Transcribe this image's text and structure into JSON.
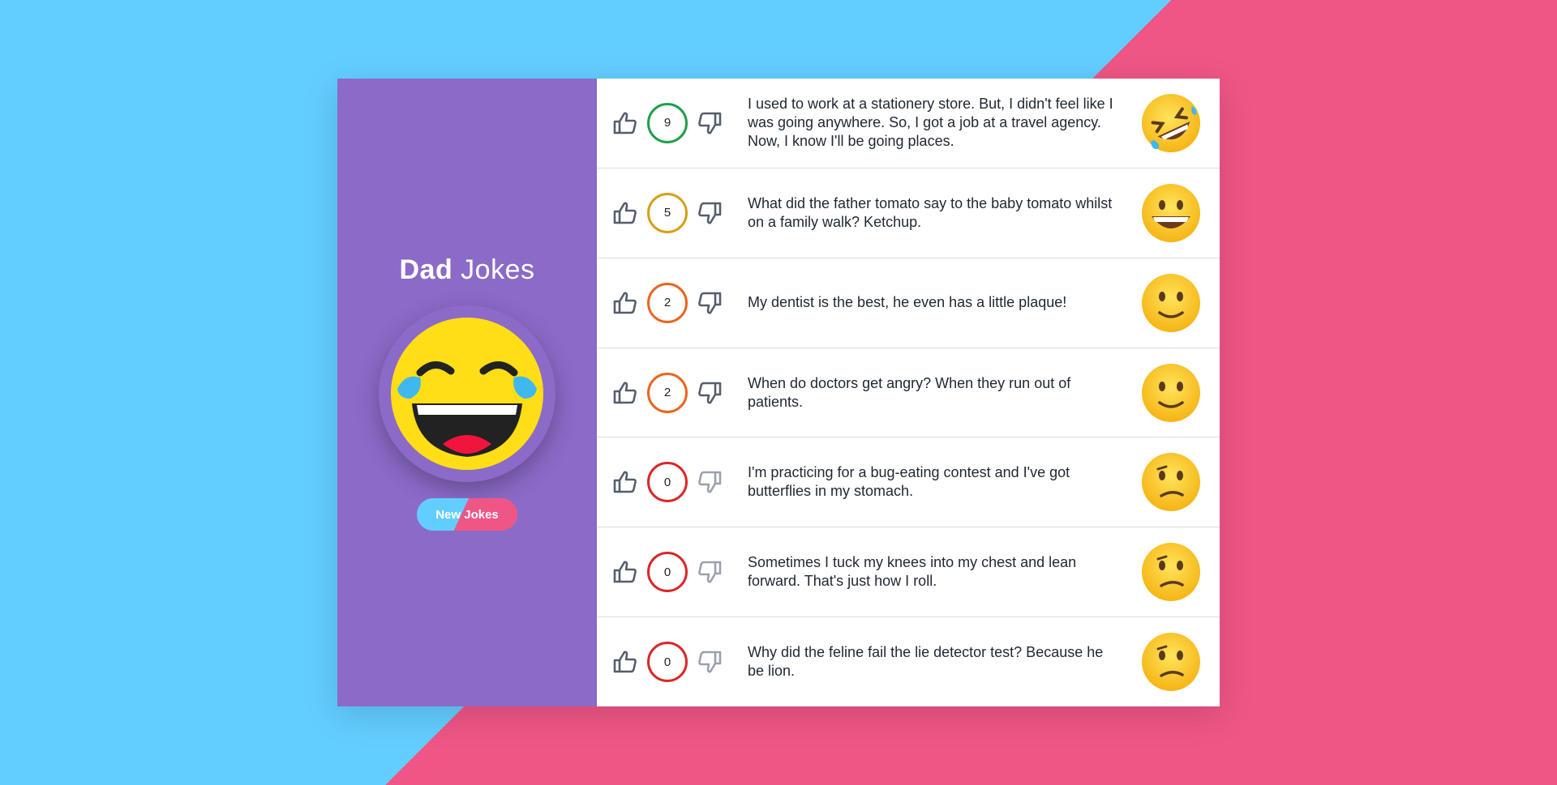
{
  "sidebar": {
    "title_bold": "Dad",
    "title_light": "Jokes",
    "new_button_label": "New Jokes",
    "hero_icon": "laughing-with-tears-icon"
  },
  "colors": {
    "bg_left": "#62ceff",
    "bg_right": "#ef5685",
    "sidebar_bg": "#8c6ac8"
  },
  "jokes": [
    {
      "score": "9",
      "ring_color": "#1f9f4a",
      "text": "I used to work at a stationery store. But, I didn't feel like I was going anywhere. So, I got a job at a travel agency. Now, I know I'll be going places.",
      "emoji": "rofl-icon"
    },
    {
      "score": "5",
      "ring_color": "#d4a015",
      "text": "What did the father tomato say to the baby tomato whilst on a family walk? Ketchup.",
      "emoji": "grinning-icon"
    },
    {
      "score": "2",
      "ring_color": "#e8661f",
      "text": "My dentist is the best, he even has a little plaque!",
      "emoji": "slight-smile-icon"
    },
    {
      "score": "2",
      "ring_color": "#e8661f",
      "text": "When do doctors get angry? When they run out of patients.",
      "emoji": "slight-smile-icon"
    },
    {
      "score": "0",
      "ring_color": "#d92828",
      "text": "I'm practicing for a bug-eating contest and I've got butterflies in my stomach.",
      "emoji": "confused-icon"
    },
    {
      "score": "0",
      "ring_color": "#d92828",
      "text": "Sometimes I tuck my knees into my chest and lean forward. That's just how I roll.",
      "emoji": "confused-icon"
    },
    {
      "score": "0",
      "ring_color": "#d92828",
      "text": "Why did the feline fail the lie detector test? Because he be lion.",
      "emoji": "confused-icon"
    }
  ]
}
